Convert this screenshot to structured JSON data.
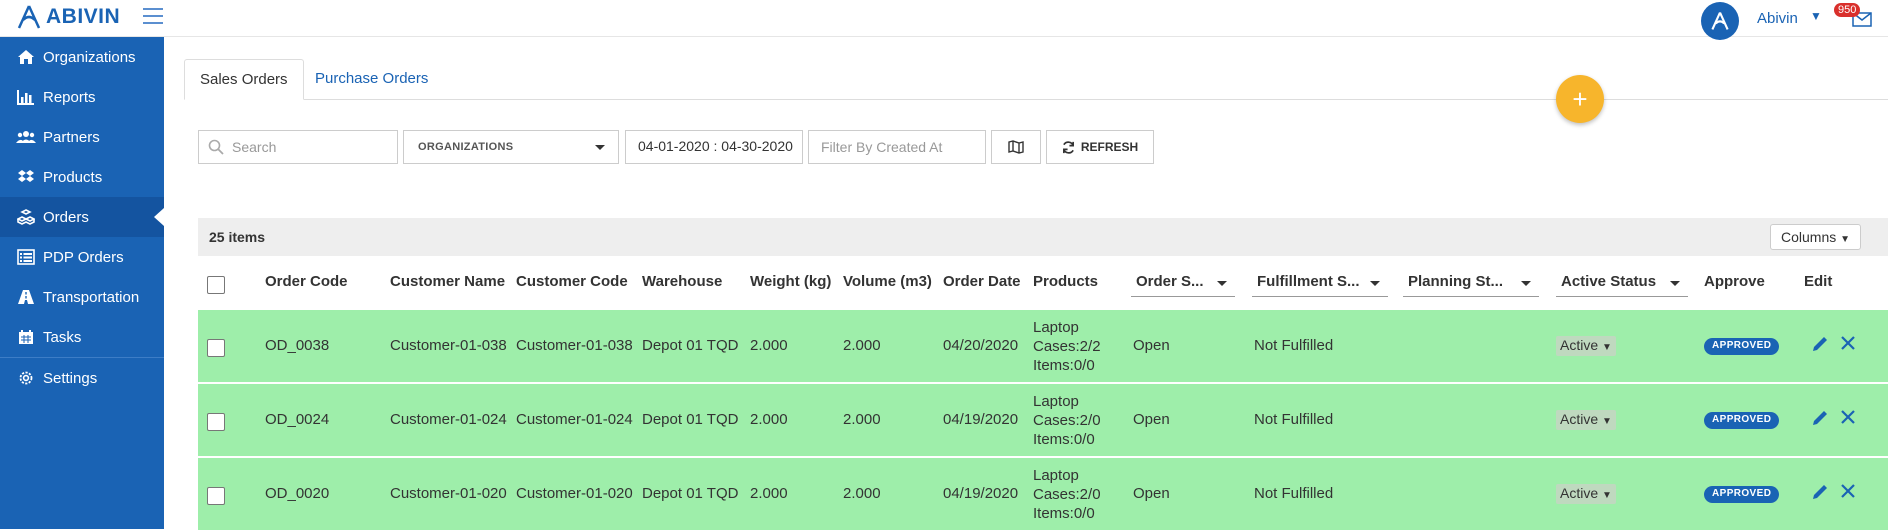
{
  "app": {
    "brand": "ABIVIN",
    "user_name": "Abivin",
    "mail_count": "950"
  },
  "sidebar": {
    "items": [
      {
        "label": "Organizations",
        "icon": "home-icon"
      },
      {
        "label": "Reports",
        "icon": "bar-chart-icon"
      },
      {
        "label": "Partners",
        "icon": "users-icon"
      },
      {
        "label": "Products",
        "icon": "dropbox-icon"
      },
      {
        "label": "Orders",
        "icon": "cubes-icon",
        "active": true
      },
      {
        "label": "PDP Orders",
        "icon": "list-icon"
      },
      {
        "label": "Transportation",
        "icon": "road-icon"
      },
      {
        "label": "Tasks",
        "icon": "calendar-icon"
      },
      {
        "label": "Settings",
        "icon": "gear-icon"
      }
    ]
  },
  "tabs": {
    "sales": "Sales Orders",
    "purchase": "Purchase Orders"
  },
  "filters": {
    "search_placeholder": "Search",
    "organizations": "ORGANIZATIONS",
    "date_range": "04-01-2020 : 04-30-2020",
    "created_placeholder": "Filter By Created At",
    "refresh": "REFRESH"
  },
  "table": {
    "items_count": "25 items",
    "columns_label": "Columns",
    "headers": {
      "order_code": "Order Code",
      "customer_name": "Customer Name",
      "customer_code": "Customer Code",
      "warehouse": "Warehouse",
      "weight": "Weight (kg)",
      "volume": "Volume (m3)",
      "order_date": "Order Date",
      "products": "Products",
      "order_status": "Order S...",
      "fulfillment_status": "Fulfillment S...",
      "planning_status": "Planning St...",
      "active_status": "Active Status",
      "approve": "Approve",
      "edit": "Edit"
    },
    "rows": [
      {
        "order_code": "OD_0038",
        "customer_name": "Customer-01-038",
        "customer_code": "Customer-01-038",
        "warehouse": "Depot 01 TQD",
        "weight": "2.000",
        "volume": "2.000",
        "order_date": "04/20/2020",
        "product_name": "Laptop",
        "product_cases": "Cases:2/2",
        "product_items": "Items:0/0",
        "order_status": "Open",
        "fulfillment_status": "Not Fulfilled",
        "active_status": "Active",
        "approve": "APPROVED"
      },
      {
        "order_code": "OD_0024",
        "customer_name": "Customer-01-024",
        "customer_code": "Customer-01-024",
        "warehouse": "Depot 01 TQD",
        "weight": "2.000",
        "volume": "2.000",
        "order_date": "04/19/2020",
        "product_name": "Laptop",
        "product_cases": "Cases:2/0",
        "product_items": "Items:0/0",
        "order_status": "Open",
        "fulfillment_status": "Not Fulfilled",
        "active_status": "Active",
        "approve": "APPROVED"
      },
      {
        "order_code": "OD_0020",
        "customer_name": "Customer-01-020",
        "customer_code": "Customer-01-020",
        "warehouse": "Depot 01 TQD",
        "weight": "2.000",
        "volume": "2.000",
        "order_date": "04/19/2020",
        "product_name": "Laptop",
        "product_cases": "Cases:2/0",
        "product_items": "Items:0/0",
        "order_status": "Open",
        "fulfillment_status": "Not Fulfilled",
        "active_status": "Active",
        "approve": "APPROVED"
      }
    ]
  },
  "colors": {
    "primary": "#1a63b4",
    "row_green": "#9eeeaa",
    "fab": "#f7b52c",
    "badge_red": "#d9302c"
  }
}
